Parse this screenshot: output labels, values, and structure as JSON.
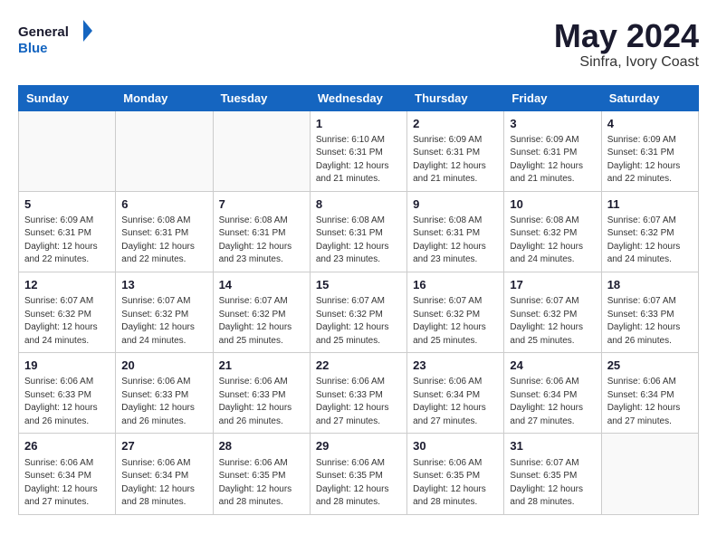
{
  "logo": {
    "line1": "General",
    "line2": "Blue"
  },
  "header": {
    "month_year": "May 2024",
    "location": "Sinfra, Ivory Coast"
  },
  "weekdays": [
    "Sunday",
    "Monday",
    "Tuesday",
    "Wednesday",
    "Thursday",
    "Friday",
    "Saturday"
  ],
  "weeks": [
    [
      {
        "day": "",
        "info": ""
      },
      {
        "day": "",
        "info": ""
      },
      {
        "day": "",
        "info": ""
      },
      {
        "day": "1",
        "info": "Sunrise: 6:10 AM\nSunset: 6:31 PM\nDaylight: 12 hours\nand 21 minutes."
      },
      {
        "day": "2",
        "info": "Sunrise: 6:09 AM\nSunset: 6:31 PM\nDaylight: 12 hours\nand 21 minutes."
      },
      {
        "day": "3",
        "info": "Sunrise: 6:09 AM\nSunset: 6:31 PM\nDaylight: 12 hours\nand 21 minutes."
      },
      {
        "day": "4",
        "info": "Sunrise: 6:09 AM\nSunset: 6:31 PM\nDaylight: 12 hours\nand 22 minutes."
      }
    ],
    [
      {
        "day": "5",
        "info": "Sunrise: 6:09 AM\nSunset: 6:31 PM\nDaylight: 12 hours\nand 22 minutes."
      },
      {
        "day": "6",
        "info": "Sunrise: 6:08 AM\nSunset: 6:31 PM\nDaylight: 12 hours\nand 22 minutes."
      },
      {
        "day": "7",
        "info": "Sunrise: 6:08 AM\nSunset: 6:31 PM\nDaylight: 12 hours\nand 23 minutes."
      },
      {
        "day": "8",
        "info": "Sunrise: 6:08 AM\nSunset: 6:31 PM\nDaylight: 12 hours\nand 23 minutes."
      },
      {
        "day": "9",
        "info": "Sunrise: 6:08 AM\nSunset: 6:31 PM\nDaylight: 12 hours\nand 23 minutes."
      },
      {
        "day": "10",
        "info": "Sunrise: 6:08 AM\nSunset: 6:32 PM\nDaylight: 12 hours\nand 24 minutes."
      },
      {
        "day": "11",
        "info": "Sunrise: 6:07 AM\nSunset: 6:32 PM\nDaylight: 12 hours\nand 24 minutes."
      }
    ],
    [
      {
        "day": "12",
        "info": "Sunrise: 6:07 AM\nSunset: 6:32 PM\nDaylight: 12 hours\nand 24 minutes."
      },
      {
        "day": "13",
        "info": "Sunrise: 6:07 AM\nSunset: 6:32 PM\nDaylight: 12 hours\nand 24 minutes."
      },
      {
        "day": "14",
        "info": "Sunrise: 6:07 AM\nSunset: 6:32 PM\nDaylight: 12 hours\nand 25 minutes."
      },
      {
        "day": "15",
        "info": "Sunrise: 6:07 AM\nSunset: 6:32 PM\nDaylight: 12 hours\nand 25 minutes."
      },
      {
        "day": "16",
        "info": "Sunrise: 6:07 AM\nSunset: 6:32 PM\nDaylight: 12 hours\nand 25 minutes."
      },
      {
        "day": "17",
        "info": "Sunrise: 6:07 AM\nSunset: 6:32 PM\nDaylight: 12 hours\nand 25 minutes."
      },
      {
        "day": "18",
        "info": "Sunrise: 6:07 AM\nSunset: 6:33 PM\nDaylight: 12 hours\nand 26 minutes."
      }
    ],
    [
      {
        "day": "19",
        "info": "Sunrise: 6:06 AM\nSunset: 6:33 PM\nDaylight: 12 hours\nand 26 minutes."
      },
      {
        "day": "20",
        "info": "Sunrise: 6:06 AM\nSunset: 6:33 PM\nDaylight: 12 hours\nand 26 minutes."
      },
      {
        "day": "21",
        "info": "Sunrise: 6:06 AM\nSunset: 6:33 PM\nDaylight: 12 hours\nand 26 minutes."
      },
      {
        "day": "22",
        "info": "Sunrise: 6:06 AM\nSunset: 6:33 PM\nDaylight: 12 hours\nand 27 minutes."
      },
      {
        "day": "23",
        "info": "Sunrise: 6:06 AM\nSunset: 6:34 PM\nDaylight: 12 hours\nand 27 minutes."
      },
      {
        "day": "24",
        "info": "Sunrise: 6:06 AM\nSunset: 6:34 PM\nDaylight: 12 hours\nand 27 minutes."
      },
      {
        "day": "25",
        "info": "Sunrise: 6:06 AM\nSunset: 6:34 PM\nDaylight: 12 hours\nand 27 minutes."
      }
    ],
    [
      {
        "day": "26",
        "info": "Sunrise: 6:06 AM\nSunset: 6:34 PM\nDaylight: 12 hours\nand 27 minutes."
      },
      {
        "day": "27",
        "info": "Sunrise: 6:06 AM\nSunset: 6:34 PM\nDaylight: 12 hours\nand 28 minutes."
      },
      {
        "day": "28",
        "info": "Sunrise: 6:06 AM\nSunset: 6:35 PM\nDaylight: 12 hours\nand 28 minutes."
      },
      {
        "day": "29",
        "info": "Sunrise: 6:06 AM\nSunset: 6:35 PM\nDaylight: 12 hours\nand 28 minutes."
      },
      {
        "day": "30",
        "info": "Sunrise: 6:06 AM\nSunset: 6:35 PM\nDaylight: 12 hours\nand 28 minutes."
      },
      {
        "day": "31",
        "info": "Sunrise: 6:07 AM\nSunset: 6:35 PM\nDaylight: 12 hours\nand 28 minutes."
      },
      {
        "day": "",
        "info": ""
      }
    ]
  ]
}
